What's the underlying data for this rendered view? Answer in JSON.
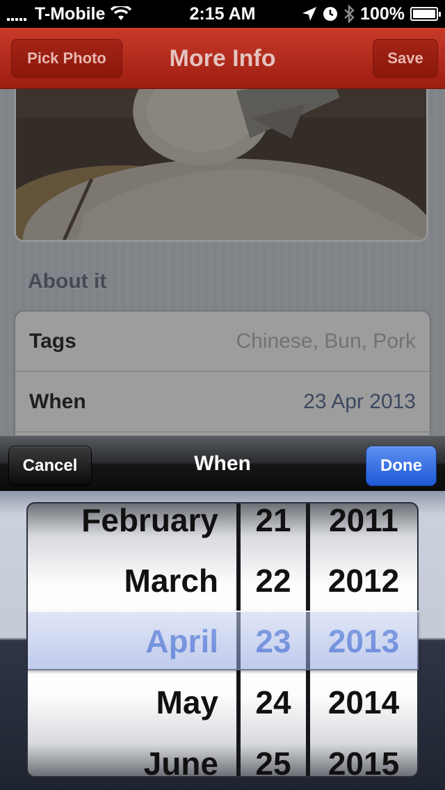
{
  "status_bar": {
    "carrier": "T-Mobile",
    "time": "2:15 AM",
    "battery": "100%",
    "wifi_icon": "wifi-icon",
    "location_icon": "location-arrow-icon",
    "alarm_icon": "clock-icon",
    "bluetooth_icon": "bluetooth-icon"
  },
  "nav": {
    "left_button": "Pick Photo",
    "title": "More Info",
    "right_button": "Save",
    "color": "#b32a1c"
  },
  "content": {
    "section_label": "About it",
    "rows": [
      {
        "label": "Tags",
        "value": "Chinese, Bun, Pork",
        "is_placeholder": true
      },
      {
        "label": "When",
        "value": "23 Apr 2013",
        "is_placeholder": false
      }
    ]
  },
  "picker": {
    "title": "When",
    "cancel_label": "Cancel",
    "done_label": "Done",
    "months": [
      "February",
      "March",
      "April",
      "May",
      "June"
    ],
    "days": [
      "21",
      "22",
      "23",
      "24",
      "25"
    ],
    "years": [
      "2011",
      "2012",
      "2013",
      "2014",
      "2015"
    ],
    "selected": {
      "month": "April",
      "day": "23",
      "year": "2013"
    },
    "accent": "#3e6cd4"
  }
}
